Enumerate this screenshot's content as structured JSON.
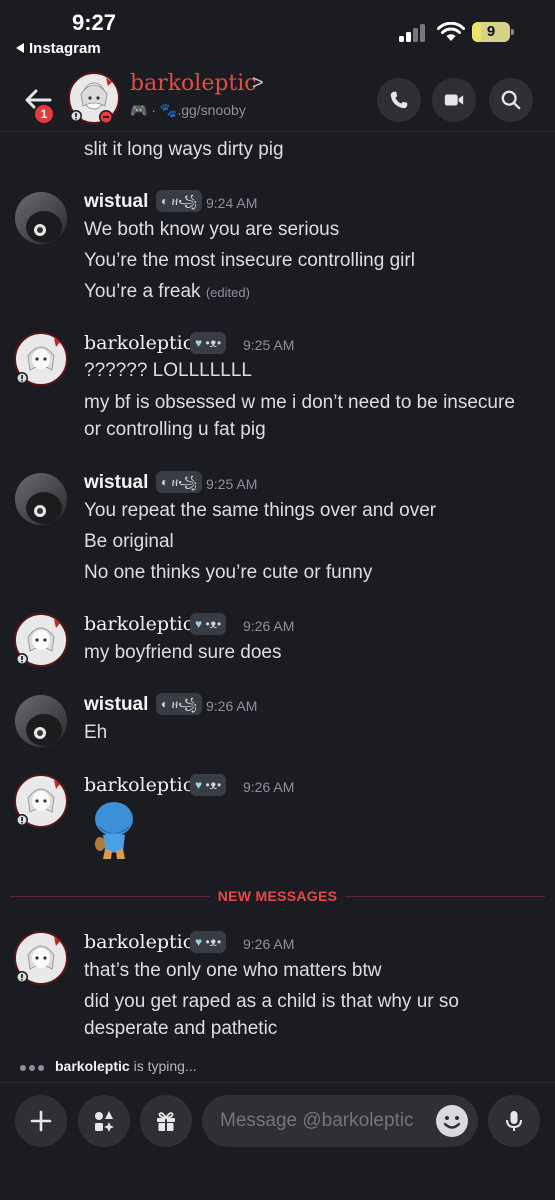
{
  "status": {
    "time": "9:27",
    "back_app": "Instagram",
    "battery": "9"
  },
  "header": {
    "badge": "1",
    "name": "barkoleptic",
    "chevron": ">",
    "subtitle": ".gg/snooby"
  },
  "messages": [
    {
      "text": "slit it long ways dirty pig"
    },
    {
      "author": "wistual",
      "tag": "ዘ꧁",
      "time": "9:24 AM",
      "lines": [
        "We both know you are serious",
        "You’re the most insecure controlling girl",
        "You’re a freak"
      ],
      "edited": "(edited)"
    },
    {
      "author": "barkoleptic",
      "tag": "•ᴥ•",
      "time": "9:25 AM",
      "lines": [
        "?????? LOLLLLLLL",
        "my bf is obsessed w me i don’t need to be insecure",
        "or controlling u fat pig"
      ]
    },
    {
      "author": "wistual",
      "tag": "ዘ꧁",
      "time": "9:25 AM",
      "lines": [
        "You repeat the same things over and over",
        "Be original",
        "No one thinks you’re cute or funny"
      ]
    },
    {
      "author": "barkoleptic",
      "tag": "•ᴥ•",
      "time": "9:26 AM",
      "lines": [
        "my boyfriend sure does"
      ]
    },
    {
      "author": "wistual",
      "tag": "ዘ꧁",
      "time": "9:26 AM",
      "lines": [
        "Eh"
      ]
    },
    {
      "author": "barkoleptic",
      "tag": "•ᴥ•",
      "time": "9:26 AM",
      "sticker": "blue-cartoon-character-sticker"
    },
    {
      "author": "barkoleptic",
      "tag": "•ᴥ•",
      "time": "9:26 AM",
      "lines": [
        "that’s the only one who matters btw",
        "did you get raped as a child is that why ur so",
        "desperate and pathetic"
      ]
    }
  ],
  "divider_label": "NEW MESSAGES",
  "typing": {
    "user": "barkoleptic",
    "suffix": " is typing..."
  },
  "composer": {
    "placeholder": "Message @barkoleptic"
  },
  "colors": {
    "bg": "#1b1c21",
    "accent_red": "#e34b4b",
    "button_bg": "#2e3036"
  }
}
